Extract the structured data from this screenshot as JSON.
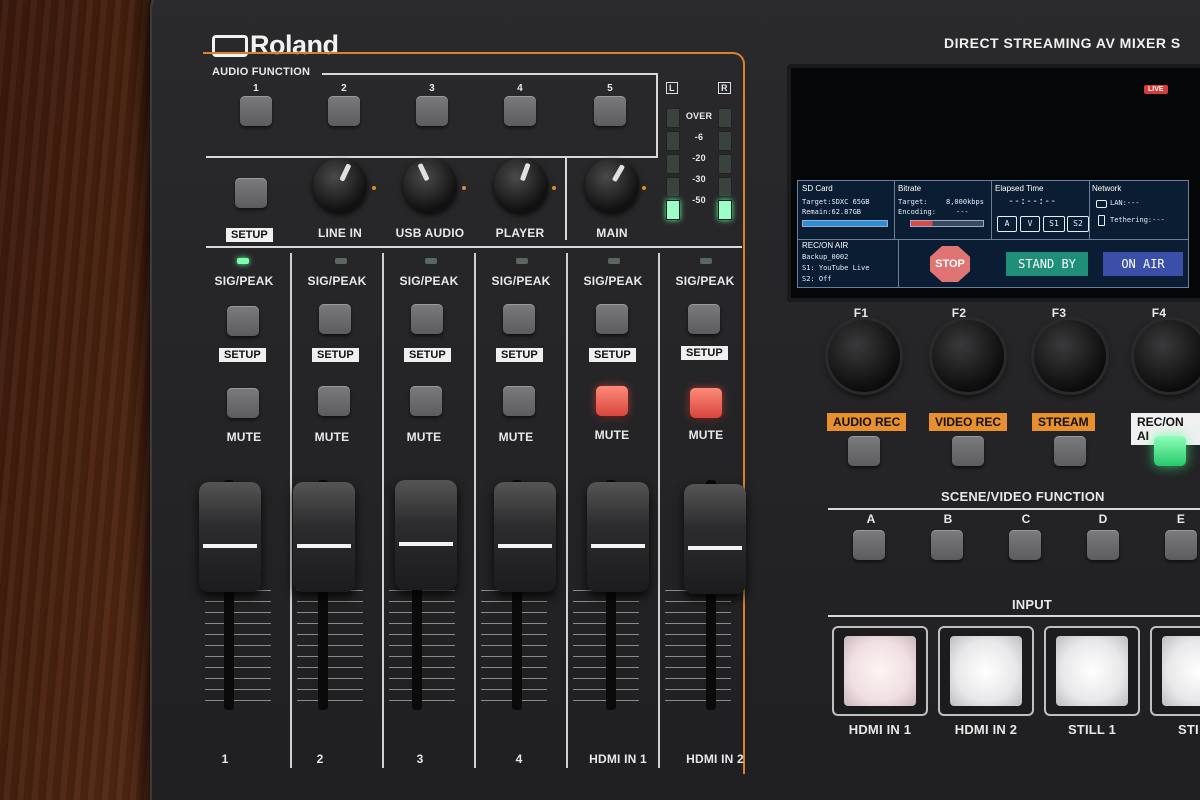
{
  "brand": {
    "logo": "Roland",
    "tagline": "DIRECT STREAMING AV MIXER S"
  },
  "audio_function": {
    "label": "AUDIO FUNCTION",
    "buttons": [
      "1",
      "2",
      "3",
      "4",
      "5"
    ]
  },
  "meter": {
    "left": "L",
    "right": "R",
    "scale": [
      "OVER",
      "-6",
      "-20",
      "-30",
      "-50"
    ]
  },
  "knob_row": {
    "setup": "SETUP",
    "knobs": [
      "LINE IN",
      "USB AUDIO",
      "PLAYER",
      "MAIN"
    ]
  },
  "channels": [
    {
      "sig": "SIG/PEAK",
      "setup": "SETUP",
      "mute": "MUTE",
      "name": "1",
      "mute_lit": false
    },
    {
      "sig": "SIG/PEAK",
      "setup": "SETUP",
      "mute": "MUTE",
      "name": "2",
      "mute_lit": false
    },
    {
      "sig": "SIG/PEAK",
      "setup": "SETUP",
      "mute": "MUTE",
      "name": "3",
      "mute_lit": false
    },
    {
      "sig": "SIG/PEAK",
      "setup": "SETUP",
      "mute": "MUTE",
      "name": "4",
      "mute_lit": false
    },
    {
      "sig": "SIG/PEAK",
      "setup": "SETUP",
      "mute": "MUTE",
      "name": "HDMI IN 1",
      "mute_lit": true
    },
    {
      "sig": "SIG/PEAK",
      "setup": "SETUP",
      "mute": "MUTE",
      "name": "HDMI IN 2",
      "mute_lit": true
    }
  ],
  "screen": {
    "live_badge": "LIVE",
    "sd_card": {
      "title": "SD Card",
      "target": "Target:SDXC 65GB",
      "remain": "Remain:62.87GB"
    },
    "bitrate": {
      "title": "Bitrate",
      "target_label": "Target:",
      "target_value": "8,000kbps",
      "encoding_label": "Encoding:",
      "encoding_value": "---"
    },
    "elapsed": {
      "title": "Elapsed Time",
      "value": "--:--:--",
      "chips": [
        "A",
        "V",
        "S1",
        "S2"
      ]
    },
    "network": {
      "title": "Network",
      "lan": "LAN:---",
      "tethering": "Tethering:---"
    },
    "rec_on_air": {
      "title": "REC/ON AIR",
      "name": "Backup_0002",
      "s1": "S1: YouTube Live",
      "s2": "S2: Off"
    },
    "stop": "STOP",
    "stand_by": "STAND BY",
    "on_air": "ON AIR"
  },
  "function_knobs": [
    "F1",
    "F2",
    "F3",
    "F4"
  ],
  "function_tags": [
    "AUDIO REC",
    "VIDEO REC",
    "STREAM",
    "REC/ON AI"
  ],
  "scene": {
    "label": "SCENE/VIDEO FUNCTION",
    "buttons": [
      "A",
      "B",
      "C",
      "D",
      "E"
    ]
  },
  "input": {
    "label": "INPUT",
    "buttons": [
      "HDMI IN 1",
      "HDMI IN 2",
      "STILL 1",
      "STI"
    ]
  },
  "colors": {
    "accent_orange": "#d9822b",
    "mute_red": "#e0554a",
    "led_green": "#5dff9a",
    "standby": "#1f8f7a",
    "on_air": "#3a4fa8",
    "stop": "#e86a6a"
  }
}
